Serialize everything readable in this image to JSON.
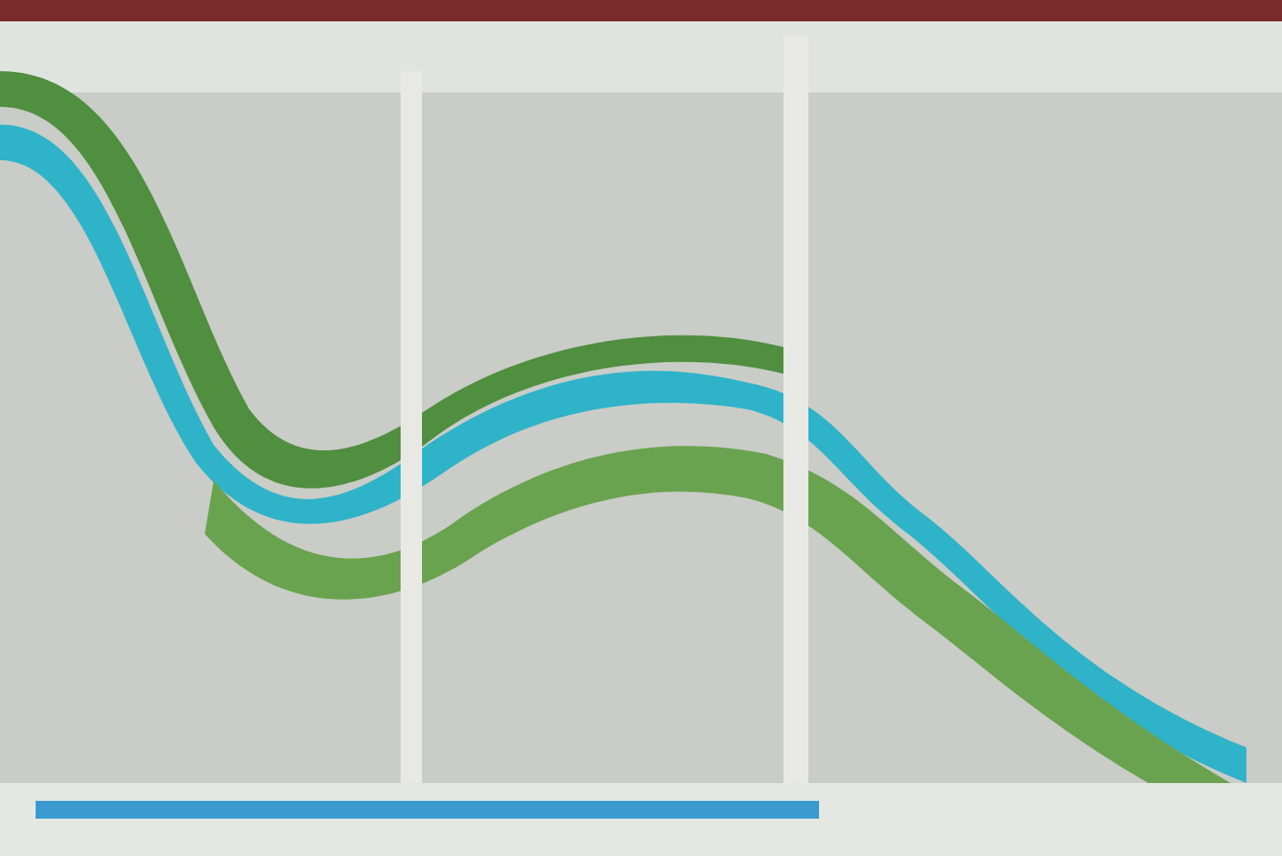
{
  "photo": {
    "kind": "map"
  }
}
